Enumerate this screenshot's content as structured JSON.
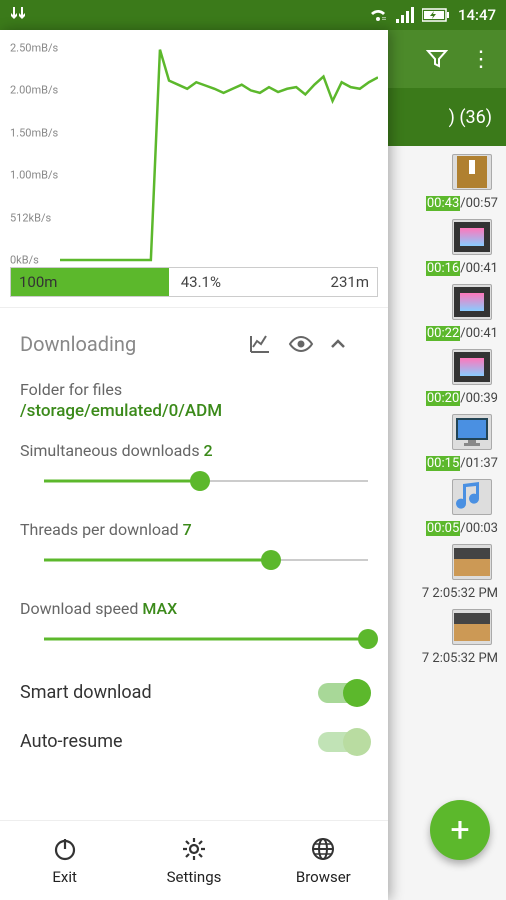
{
  "status": {
    "time": "14:47"
  },
  "background": {
    "header_count": ") (36)",
    "items": [
      {
        "time_a": "00:43",
        "time_b": "/00:57",
        "type": "zip"
      },
      {
        "time_a": "00:16",
        "time_b": "/00:41",
        "type": "video"
      },
      {
        "time_a": "00:22",
        "time_b": "/00:41",
        "type": "video"
      },
      {
        "time_a": "00:20",
        "time_b": "/00:39",
        "type": "video"
      },
      {
        "time_a": "00:15",
        "time_b": "/01:37",
        "type": "monitor"
      },
      {
        "time_a": "00:05",
        "time_b": "/00:03",
        "type": "audio"
      },
      {
        "date": "7 2:05:32 PM",
        "type": "image"
      },
      {
        "date": "7 2:05:32 PM",
        "type": "image"
      }
    ]
  },
  "chart_data": {
    "type": "line",
    "ylabel_unit": "mB/s",
    "y_ticks": [
      "2.50mB/s",
      "2.00mB/s",
      "1.50mB/s",
      "1.00mB/s",
      "512kB/s",
      "0kB/s"
    ],
    "ylim": [
      0,
      2.6
    ],
    "series": [
      {
        "name": "speed",
        "values": [
          0,
          0,
          0,
          0,
          0,
          0,
          0,
          0,
          0,
          0,
          0,
          2.58,
          2.2,
          2.15,
          2.1,
          2.18,
          2.14,
          2.1,
          2.05,
          2.1,
          2.15,
          2.08,
          2.05,
          2.12,
          2.06,
          2.1,
          2.12,
          2.03,
          2.15,
          2.25,
          1.95,
          2.18,
          2.12,
          2.1,
          2.18,
          2.24
        ]
      }
    ]
  },
  "progress": {
    "done": "100m",
    "percent": "43.1%",
    "total": "231m",
    "percent_num": 43.1
  },
  "section": {
    "title": "Downloading"
  },
  "settings": {
    "folder_label": "Folder for files",
    "folder_path": "/storage/emulated/0/ADM",
    "sim_label": "Simultaneous downloads ",
    "sim_value": "2",
    "threads_label": "Threads per download ",
    "threads_value": "7",
    "speed_label": "Download speed ",
    "speed_value": "MAX",
    "smart_label": "Smart download",
    "resume_label": "Auto-resume"
  },
  "nav": {
    "exit": "Exit",
    "settings": "Settings",
    "browser": "Browser"
  }
}
